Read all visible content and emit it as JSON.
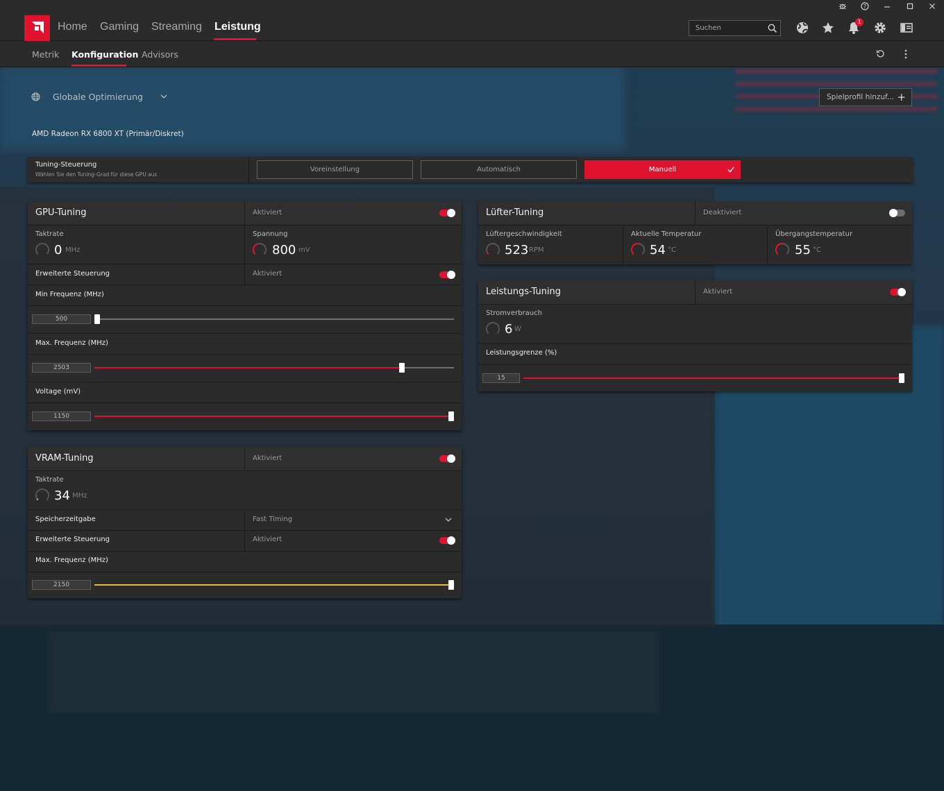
{
  "nav": {
    "tabs": [
      "Home",
      "Gaming",
      "Streaming",
      "Leistung"
    ],
    "active_tab": "Leistung",
    "search_placeholder": "Suchen",
    "notification_count": "1"
  },
  "subnav": {
    "tabs": [
      "Metrik",
      "Konfiguration",
      "Advisors"
    ],
    "active_tab": "Konfiguration"
  },
  "profile": {
    "selector_label": "Globale Optimierung",
    "add_profile_label": "Spielprofil hinzuf..."
  },
  "gpu_name": "AMD Radeon RX 6800 XT (Primär/Diskret)",
  "tuning_control": {
    "title": "Tuning-Steuerung",
    "subtitle": "Wählen Sie den Tuning-Grad für diese GPU aus",
    "options": [
      "Voreinstellung",
      "Automatisch",
      "Manuell"
    ],
    "selected": "Manuell"
  },
  "gpu_tuning": {
    "title": "GPU-Tuning",
    "status": "Aktiviert",
    "enabled": true,
    "clock": {
      "label": "Taktrate",
      "value": "0",
      "unit": "MHz"
    },
    "voltage": {
      "label": "Spannung",
      "value": "800",
      "unit": "mV"
    },
    "advanced": {
      "label": "Erweiterte Steuerung",
      "status": "Aktiviert",
      "enabled": true
    },
    "min_freq": {
      "label": "Min Frequenz (MHz)",
      "value": "500",
      "fraction": 0.0
    },
    "max_freq": {
      "label": "Max. Frequenz (MHz)",
      "value": "2503",
      "fraction": 0.86
    },
    "voltage_slider": {
      "label": "Voltage (mV)",
      "value": "1150",
      "fraction": 1.0
    }
  },
  "vram_tuning": {
    "title": "VRAM-Tuning",
    "status": "Aktiviert",
    "enabled": true,
    "clock": {
      "label": "Taktrate",
      "value": "34",
      "unit": "MHz"
    },
    "memory_timing": {
      "label": "Speicherzeitgabe",
      "value": "Fast Timing"
    },
    "advanced": {
      "label": "Erweiterte Steuerung",
      "status": "Aktiviert",
      "enabled": true
    },
    "max_freq": {
      "label": "Max. Frequenz (MHz)",
      "value": "2150",
      "fraction": 1.0
    }
  },
  "fan_tuning": {
    "title": "Lüfter-Tuning",
    "status": "Deaktiviert",
    "enabled": false,
    "fan_speed": {
      "label": "Lüftergeschwindigkeit",
      "value": "523",
      "unit": "RPM"
    },
    "current_temp": {
      "label": "Aktuelle Temperatur",
      "value": "54",
      "unit": "°C"
    },
    "junction_temp": {
      "label": "Übergangstemperatur",
      "value": "55",
      "unit": "°C"
    }
  },
  "power_tuning": {
    "title": "Leistungs-Tuning",
    "status": "Aktiviert",
    "enabled": true,
    "power_draw": {
      "label": "Stromverbrauch",
      "value": "6",
      "unit": "W"
    },
    "power_limit": {
      "label": "Leistungsgrenze (%)",
      "value": "15",
      "fraction": 1.0
    }
  },
  "colors": {
    "accent": "#e0132e",
    "vram_accent": "#e8b93e",
    "panel": "#2b2b2b"
  }
}
